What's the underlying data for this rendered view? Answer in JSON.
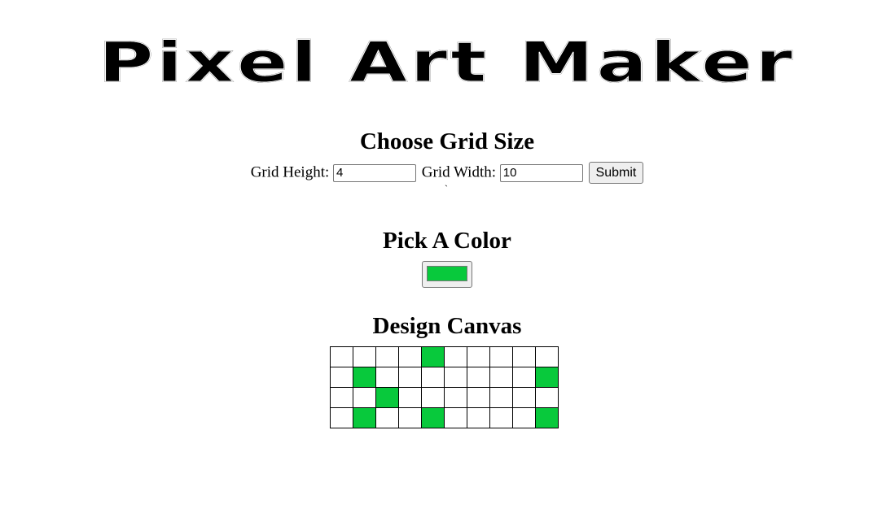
{
  "app": {
    "logo_text": "Pixel Art Maker"
  },
  "grid_size": {
    "heading": "Choose Grid Size",
    "height_label": "Grid Height:",
    "height_value": "4",
    "width_label": "Grid Width:",
    "width_value": "10",
    "submit_label": "Submit",
    "stray_mark": "`"
  },
  "color": {
    "heading": "Pick A Color",
    "selected": "#08c93c"
  },
  "canvas": {
    "heading": "Design Canvas",
    "rows": 4,
    "cols": 10,
    "cells": [
      [
        0,
        0,
        0,
        0,
        1,
        0,
        0,
        0,
        0,
        0
      ],
      [
        0,
        1,
        0,
        0,
        0,
        0,
        0,
        0,
        0,
        1
      ],
      [
        0,
        0,
        1,
        0,
        0,
        0,
        0,
        0,
        0,
        0
      ],
      [
        0,
        1,
        0,
        0,
        1,
        0,
        0,
        0,
        0,
        1
      ]
    ],
    "fill_color": "#08c93c",
    "empty_color": "#ffffff"
  }
}
